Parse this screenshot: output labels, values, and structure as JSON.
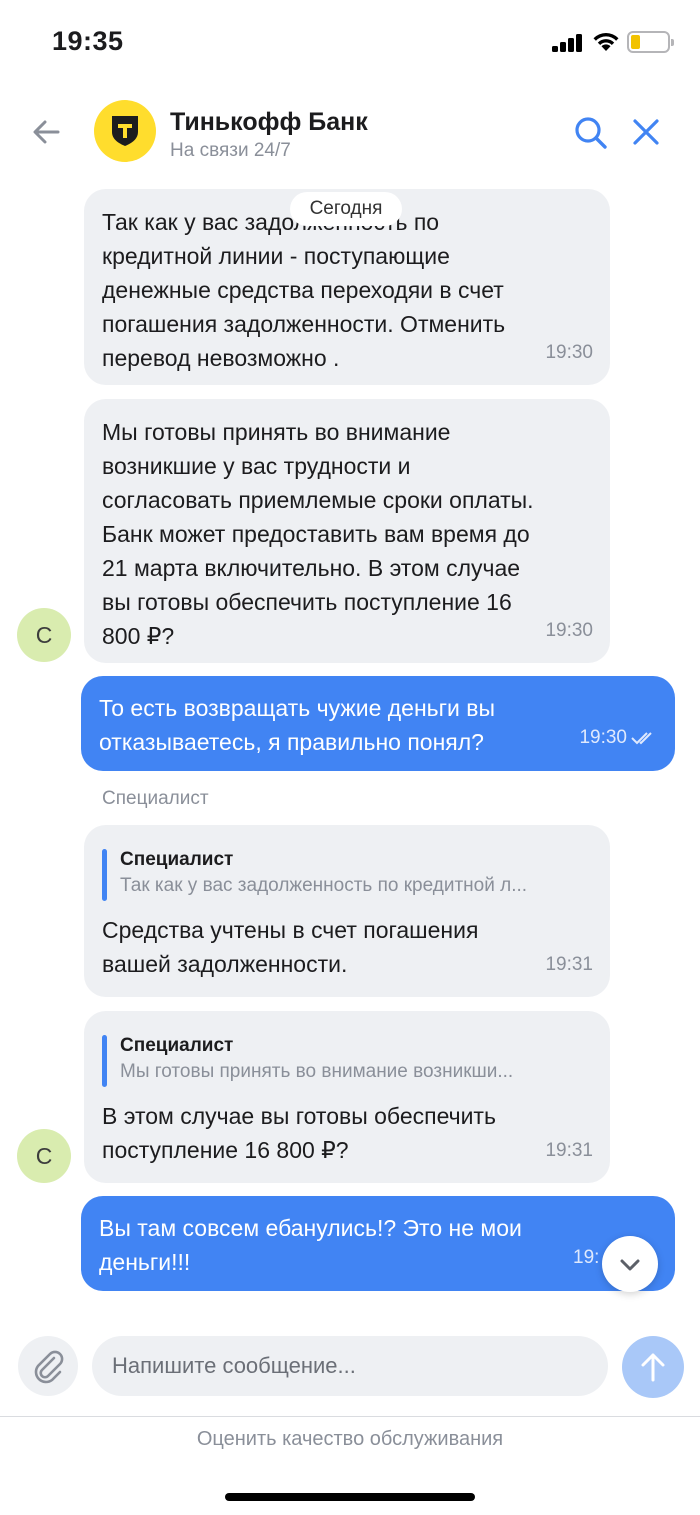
{
  "status_bar": {
    "time": "19:35",
    "battery_level": 0.25
  },
  "header": {
    "title": "Тинькофф Банк",
    "subtitle": "На связи 24/7",
    "logo_color": "#ffdd2d"
  },
  "chat": {
    "date_separator": "Сегодня",
    "messages": [
      {
        "direction": "in",
        "text": "Так как у вас задолженность по\nкредитной линии - поступающие\nденежные средства переходяи в счет\nпогашения задолженности. Отменить\nперевод невозможно .",
        "time": "19:30"
      },
      {
        "direction": "in",
        "text": "Мы готовы принять во внимание\nвозникшие у вас трудности и\nсогласовать приемлемые сроки оплаты.\nБанк может предоставить вам время  до\n21 марта включительно. В этом случае\nвы готовы обеспечить поступление 16\n800 ₽?",
        "time": "19:30",
        "avatar": "С"
      },
      {
        "direction": "out",
        "text": "То есть возвращать чужие деньги вы\nотказываетесь, я правильно понял?",
        "time": "19:30",
        "read": true
      },
      {
        "direction": "in",
        "sender": "Специалист",
        "quote_author": "Специалист",
        "quote_text": "Так как у вас задолженность по кредитной л...",
        "text": "Средства учтены в счет погашения\nвашей задолженности.",
        "time": "19:31"
      },
      {
        "direction": "in",
        "quote_author": "Специалист",
        "quote_text": "Мы готовы принять во внимание возникши...",
        "text": "В этом случае вы готовы обеспечить\nпоступление 16 800 ₽?",
        "time": "19:31",
        "avatar": "С"
      },
      {
        "direction": "out",
        "text": "Вы там совсем ебанулись!? Это не мои\nденьги!!!",
        "time": "19:"
      }
    ]
  },
  "composer": {
    "placeholder": "Напишите сообщение..."
  },
  "footer": {
    "rate_label": "Оценить качество обслуживания"
  },
  "colors": {
    "accent": "#4184f3",
    "incoming_bubble": "#eef0f3",
    "avatar_bg": "#d9ecaf"
  }
}
